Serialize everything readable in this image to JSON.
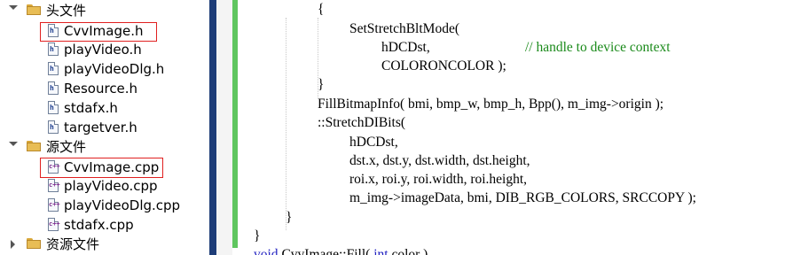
{
  "tree": {
    "folders": {
      "headers": "头文件",
      "sources": "源文件",
      "resources": "资源文件"
    },
    "header_files": [
      "CvvImage.h",
      "playVideo.h",
      "playVideoDlg.h",
      "Resource.h",
      "stdafx.h",
      "targetver.h"
    ],
    "source_files": [
      "CvvImage.cpp",
      "playVideo.cpp",
      "playVideoDlg.cpp",
      "stdafx.cpp"
    ],
    "icon_labels": {
      "h": "h",
      "cpp": "c++"
    }
  },
  "code": {
    "lines": [
      "{",
      "SetStretchBltMode(",
      "hDCDst,",
      "// handle to device context",
      "COLORONCOLOR );",
      "}",
      "FillBitmapInfo( bmi, bmp_w, bmp_h, Bpp(), m_img->origin );",
      "::StretchDIBits(",
      "hDCDst,",
      "dst.x, dst.y, dst.width, dst.height,",
      "roi.x, roi.y, roi.width, roi.height,",
      "m_img->imageData, bmi, DIB_RGB_COLORS, SRCCOPY );",
      "}",
      "}"
    ],
    "partial_line": {
      "kw1": "void",
      "mid": " CvvImage::Fill( ",
      "kw2": "int",
      "rest": " color )"
    }
  },
  "colors": {
    "highlight_box": "#e02020",
    "comment": "#1a8a1a",
    "keyword": "#2020c0",
    "change_bar": "#5fc65f",
    "separator": "#1e3d78"
  }
}
